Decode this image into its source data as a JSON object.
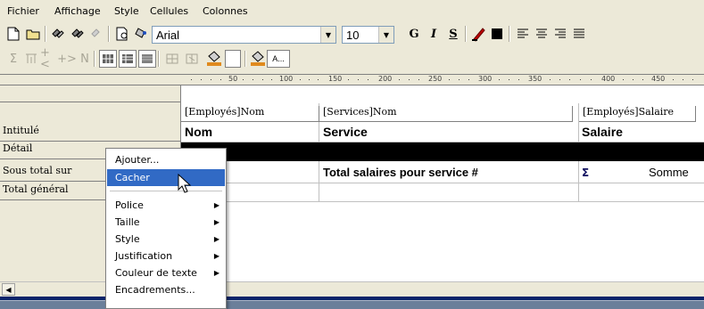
{
  "menu": [
    "Fichier",
    "Affichage",
    "Style",
    "Cellules",
    "Colonnes"
  ],
  "toolbar": {
    "font_name": "Arial",
    "font_size": "10",
    "bold_glyph": "G",
    "italic_glyph": "I",
    "underline_glyph": "S",
    "text_sample": "A..."
  },
  "ruler": {
    "marks": [
      "50",
      "100",
      "150",
      "200",
      "250",
      "300",
      "350",
      "400",
      "450"
    ]
  },
  "rows": {
    "intitule": "Intitulé",
    "detail": "Détail",
    "sous_total": "Sous total sur",
    "total_general": "Total général"
  },
  "fields": {
    "nom": "[Employés]Nom",
    "service": "[Services]Nom",
    "salaire": "[Employés]Salaire"
  },
  "columns": {
    "nom": "Nom",
    "service": "Service",
    "salaire": "Salaire"
  },
  "subtotal": {
    "label": "Total salaires pour service #",
    "sum_label": "Somme"
  },
  "context_menu": {
    "items": [
      "Ajouter...",
      "Cacher",
      "Police",
      "Taille",
      "Style",
      "Justification",
      "Couleur de texte",
      "Encadrements..."
    ],
    "selected": "Cacher"
  },
  "colors": {
    "chrome": "#ece9d8",
    "highlight": "#316ac5",
    "detail_bar": "#000000"
  }
}
